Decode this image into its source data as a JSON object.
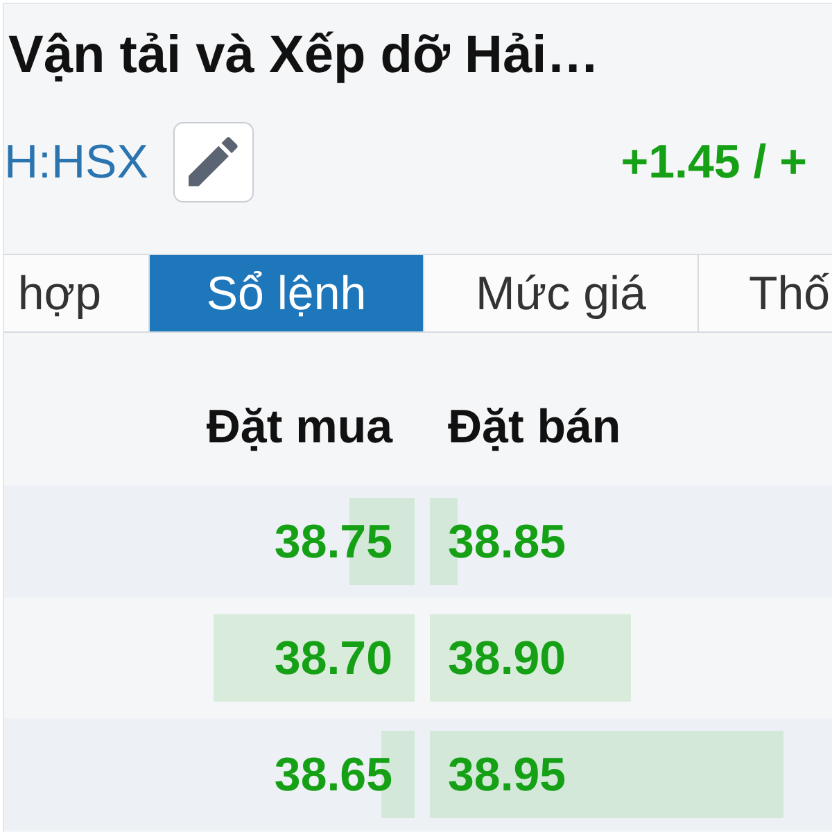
{
  "header": {
    "title": "Vận tải và Xếp dỡ Hải…",
    "ticker": "H:HSX",
    "change": "+1.45 / +"
  },
  "tabs": [
    {
      "label": "hợp",
      "selected": false
    },
    {
      "label": "Sổ lệnh",
      "selected": true
    },
    {
      "label": "Mức giá",
      "selected": false
    },
    {
      "label": "Thố",
      "selected": false
    }
  ],
  "order_book": {
    "columns": [
      "Đặt mua",
      "Đặt bán"
    ],
    "rows": [
      {
        "bid": {
          "price": "38.75",
          "level": 0.16
        },
        "ask": {
          "price": "38.85",
          "level": 0.07
        }
      },
      {
        "bid": {
          "price": "38.70",
          "level": 0.49
        },
        "ask": {
          "price": "38.90",
          "level": 0.5
        }
      },
      {
        "bid": {
          "price": "38.65",
          "level": 0.08
        },
        "ask": {
          "price": "38.95",
          "level": 0.88
        }
      }
    ]
  }
}
